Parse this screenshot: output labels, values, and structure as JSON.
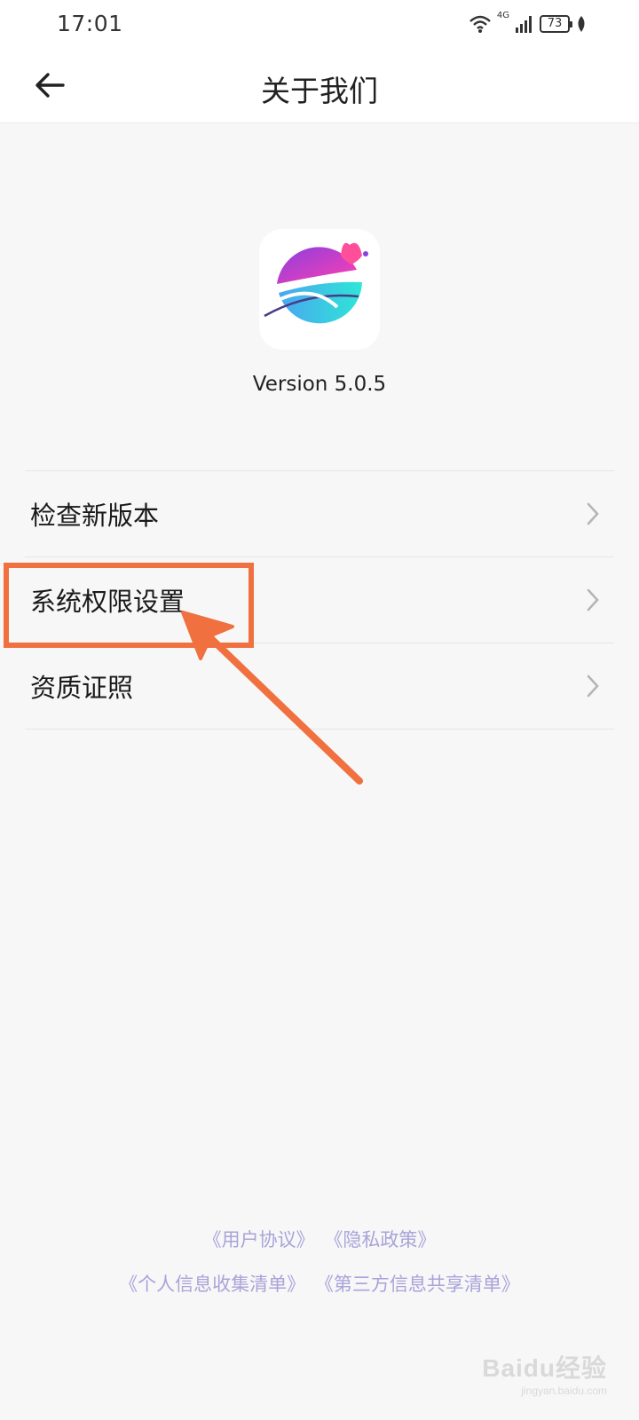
{
  "status_bar": {
    "time": "17:01",
    "network": "4G",
    "battery": "73",
    "icons": [
      "wifi-icon",
      "signal-icon",
      "battery-icon",
      "leaf-icon"
    ]
  },
  "header": {
    "title": "关于我们",
    "back_icon": "back-arrow-icon"
  },
  "app": {
    "version": "Version 5.0.5"
  },
  "menu": [
    {
      "label": "检查新版本"
    },
    {
      "label": "系统权限设置"
    },
    {
      "label": "资质证照"
    }
  ],
  "footer": {
    "line1": [
      "《用户协议》",
      "《隐私政策》"
    ],
    "line2": [
      "《个人信息收集清单》",
      "《第三方信息共享清单》"
    ]
  },
  "watermark": {
    "logo": "Baidu经验",
    "url": "jingyan.baidu.com"
  },
  "colors": {
    "annotation": "#f0703f",
    "footer_link": "#a9a3d9",
    "background": "#f7f7f7"
  }
}
